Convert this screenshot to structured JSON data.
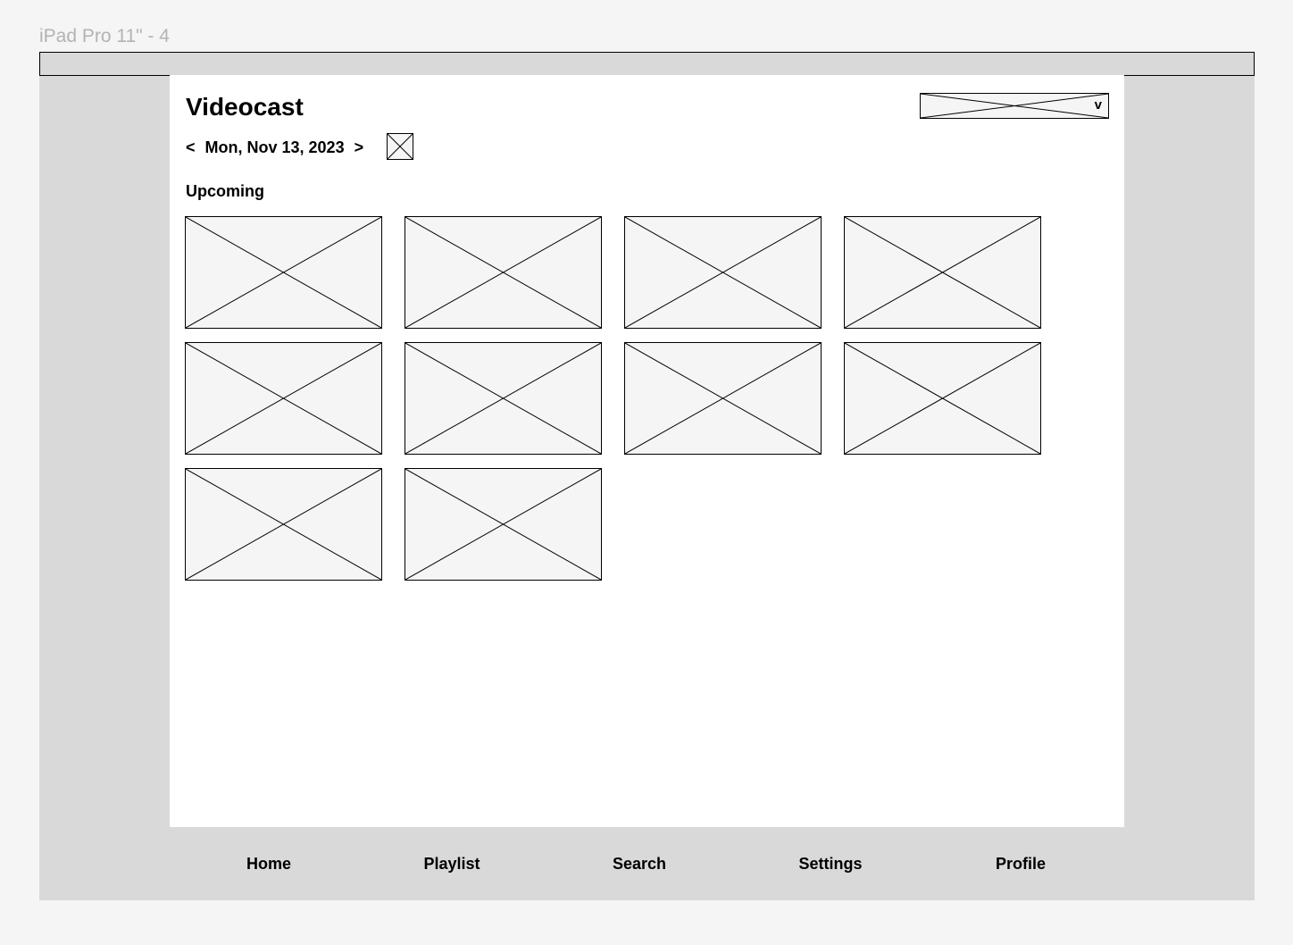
{
  "frame": {
    "label": "iPad Pro 11\" - 4"
  },
  "header": {
    "title": "Videocast",
    "dropdown_caret": "v"
  },
  "date_nav": {
    "prev": "<",
    "date": "Mon, Nov 13, 2023",
    "next": ">"
  },
  "upcoming": {
    "title": "Upcoming",
    "tile_count": 10
  },
  "nav": {
    "items": [
      {
        "label": "Home"
      },
      {
        "label": "Playlist"
      },
      {
        "label": "Search"
      },
      {
        "label": "Settings"
      },
      {
        "label": "Profile"
      }
    ]
  },
  "colors": {
    "canvas": "#f5f5f5",
    "device": "#d9d9d9",
    "content": "#ffffff",
    "placeholder": "#f5f5f5",
    "stroke": "#000000",
    "frame_label": "#b3b3b3"
  }
}
